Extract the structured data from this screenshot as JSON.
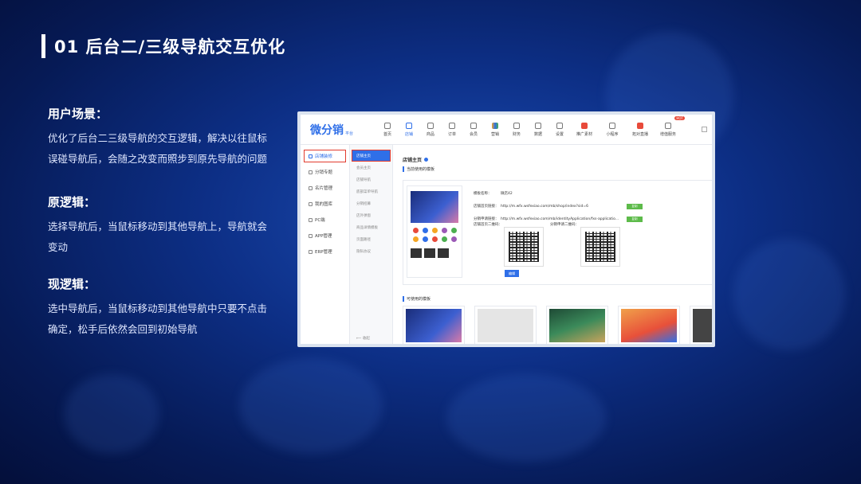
{
  "slide": {
    "title": "01 后台二/三级导航交互优化",
    "sections": [
      {
        "heading": "用户场景：",
        "body": "优化了后台二三级导航的交互逻辑，解决以往鼠标误碰导航后，会随之改变而照步到原先导航的问题"
      },
      {
        "heading": "原逻辑：",
        "body": "选择导航后，当鼠标移动到其他导航上，导航就会变动"
      },
      {
        "heading": "现逻辑：",
        "body": "选中导航后，当鼠标移动到其他导航中只要不点击确定，松手后依然会回到初始导航"
      }
    ]
  },
  "app": {
    "logo": "微分销",
    "logo_sub": "平台",
    "nav": [
      {
        "label": "首页",
        "icon": "home-icon"
      },
      {
        "label": "店铺",
        "icon": "shop-icon",
        "active": true
      },
      {
        "label": "商品",
        "icon": "goods-icon"
      },
      {
        "label": "订单",
        "icon": "order-icon"
      },
      {
        "label": "会员",
        "icon": "member-icon"
      },
      {
        "label": "营销",
        "icon": "marketing-icon"
      },
      {
        "label": "财务",
        "icon": "finance-icon"
      },
      {
        "label": "数据",
        "icon": "data-icon"
      },
      {
        "label": "设置",
        "icon": "settings-icon"
      },
      {
        "label": "推广素材",
        "icon": "promo-icon"
      },
      {
        "label": "小程序",
        "icon": "miniapp-icon"
      },
      {
        "label": "拓对直播",
        "icon": "live-icon"
      },
      {
        "label": "增值服务",
        "icon": "service-icon"
      }
    ],
    "hot_badge": "HOT",
    "sidebar1": [
      {
        "label": "店铺装修",
        "active": true
      },
      {
        "label": "分销专题"
      },
      {
        "label": "名片管理"
      },
      {
        "label": "我的图库"
      },
      {
        "label": "PC端"
      },
      {
        "label": "APP管理"
      },
      {
        "label": "ERP管理"
      }
    ],
    "sidebar2": [
      {
        "label": "店铺主页",
        "active": true
      },
      {
        "label": "会员主页"
      },
      {
        "label": "店铺导航"
      },
      {
        "label": "底部菜单导航"
      },
      {
        "label": "分销招募"
      },
      {
        "label": "店外弹窗"
      },
      {
        "label": "商品详情模板"
      },
      {
        "label": "页面路径"
      },
      {
        "label": "隐私协议"
      }
    ],
    "sidebar2_collapse": "收起",
    "content": {
      "title": "店铺主页",
      "current_template_label": "当前使用的模板",
      "template_name_label": "模板名称：",
      "template_name": "微店42",
      "shop_link_label": "店铺首页链接：",
      "shop_link": "http://m.wfx.wsfexiao.com/mb/shop/index?sid=6",
      "apply_link_label": "分销申请链接：",
      "apply_link": "http://m.wfx.wsfexiao.com/mb/identityApplication/fxs-applicatio...",
      "copy_label": "复制",
      "qr1_label": "店铺首页二维码：",
      "qr2_label": "分销申请二维码：",
      "edit_label": "编辑",
      "available_label": "可使用的模板"
    }
  }
}
